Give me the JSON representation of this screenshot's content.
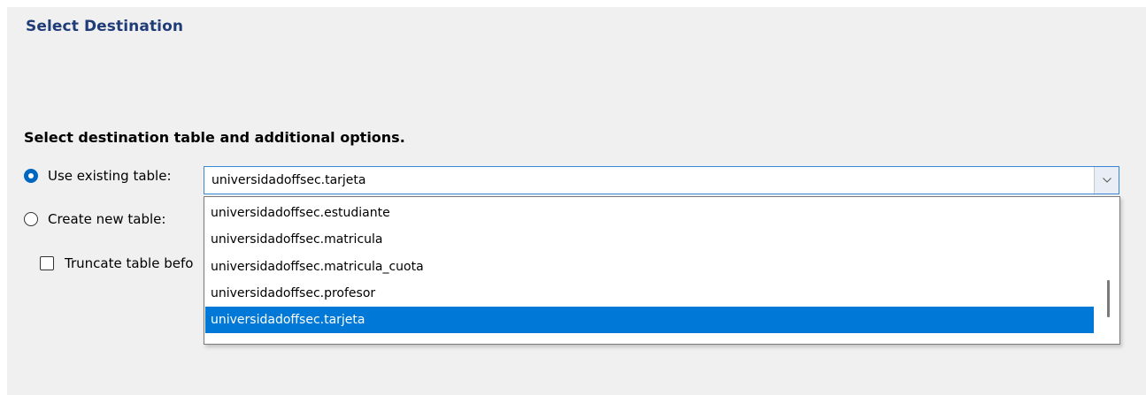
{
  "dialog": {
    "title": "Select Destination",
    "section_title": "Select destination table and additional options."
  },
  "options": {
    "use_existing": {
      "label": "Use existing table:",
      "checked": true
    },
    "create_new": {
      "label": "Create new table:",
      "checked": false
    },
    "truncate": {
      "label": "Truncate table befo",
      "checked": false
    }
  },
  "combo": {
    "value": "universidadoffsec.tarjeta",
    "icon": "chevron-down-icon"
  },
  "dropdown": {
    "items": [
      "universidadoffsec.estudiante",
      "universidadoffsec.matricula",
      "universidadoffsec.matricula_cuota",
      "universidadoffsec.profesor",
      "universidadoffsec.tarjeta"
    ],
    "selected_index": 4
  },
  "colors": {
    "header": "#1f3c78",
    "accent": "#0067c0",
    "selection": "#0078d7",
    "background": "#f0f0f0"
  }
}
